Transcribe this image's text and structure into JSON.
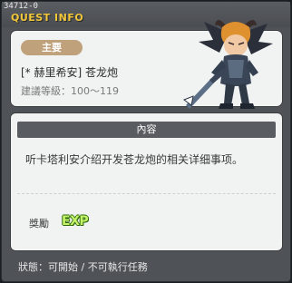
{
  "window": {
    "quest_id": "34712-0",
    "title": "QUEST INFO"
  },
  "quest": {
    "category_badge": "主要",
    "name": "[* 赫里希安] 苍龙炮",
    "level_requirement": "建議等級：100～119"
  },
  "content": {
    "header": "內容",
    "description": "听卡塔利安介绍开发苍龙炮的相关详细事项。",
    "reward_label": "獎勵",
    "reward_exp": "EXP"
  },
  "status": {
    "text": "狀態：可開始 / 不可執行任務"
  },
  "colors": {
    "title_yellow": "#f3c73a",
    "badge_tan": "#bfa17b",
    "exp_green": "#c6f26a"
  }
}
